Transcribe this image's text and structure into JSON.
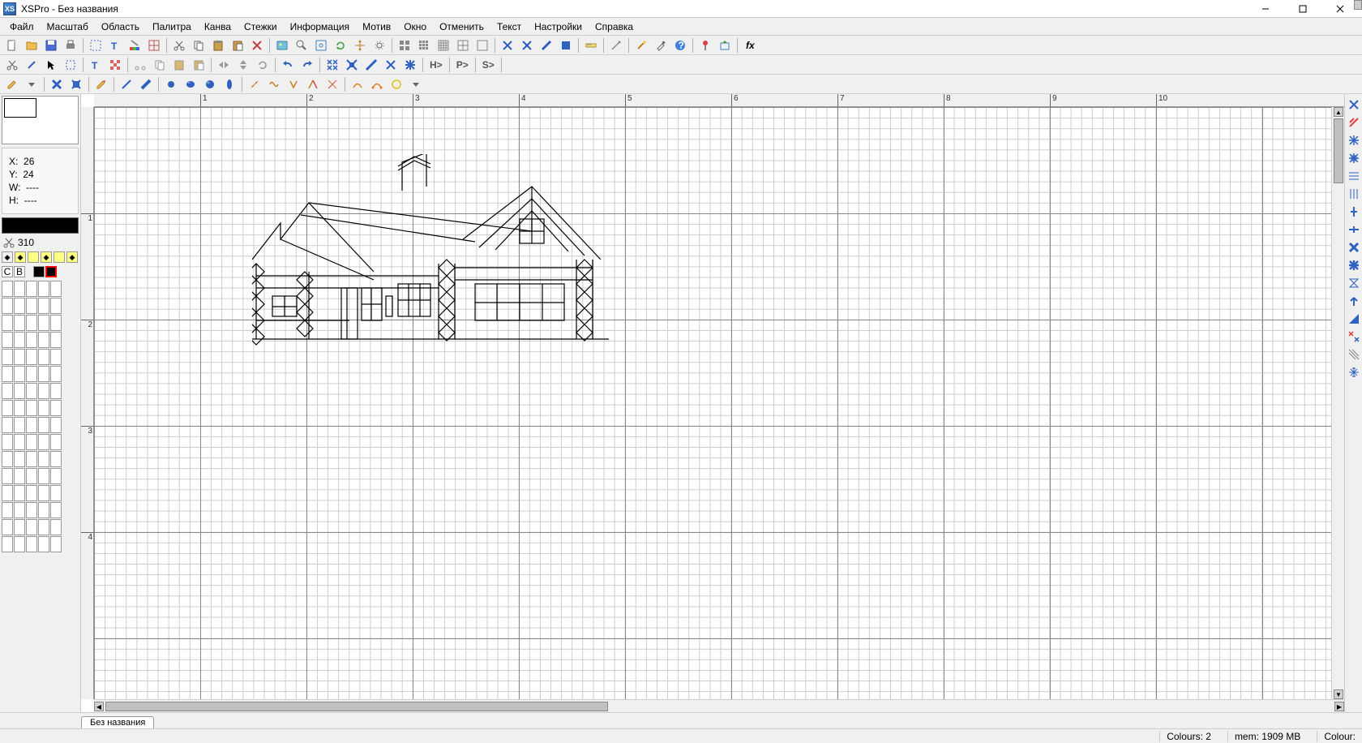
{
  "app": {
    "icon_text": "XS",
    "title": "XSPro - Без названия"
  },
  "menu": [
    "Файл",
    "Масштаб",
    "Область",
    "Палитра",
    "Канва",
    "Стежки",
    "Информация",
    "Мотив",
    "Окно",
    "Отменить",
    "Текст",
    "Настройки",
    "Справка"
  ],
  "coords": {
    "x_label": "X:",
    "x": "26",
    "y_label": "Y:",
    "y": "24",
    "w_label": "W:",
    "w": "----",
    "h_label": "H:",
    "h": "----"
  },
  "thread": {
    "code": "310"
  },
  "palette_header": {
    "c": "C",
    "b": "B"
  },
  "ruler_h": [
    "1",
    "2",
    "3",
    "4",
    "5",
    "6",
    "7",
    "8",
    "9",
    "10"
  ],
  "ruler_v": [
    "1",
    "2",
    "3",
    "4"
  ],
  "doc_tab": "Без названия",
  "status": {
    "colours_label": "Colours:",
    "colours": "2",
    "mem_label": "mem:",
    "mem": "1909 MB",
    "colour_label": "Colour:"
  },
  "toolbar2_labels": {
    "h": "H>",
    "p": "P>",
    "s": "S>"
  }
}
